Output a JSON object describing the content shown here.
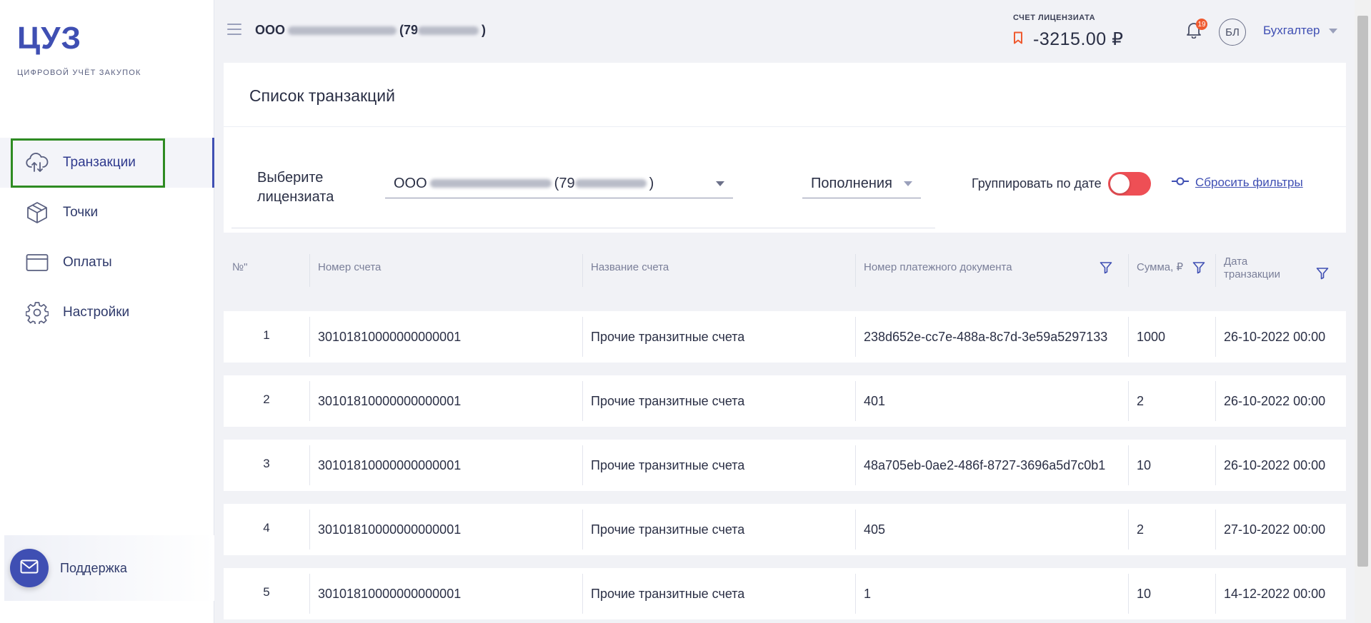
{
  "app": {
    "logo_title": "ЦУЗ",
    "logo_subtitle": "ЦИФРОВОЙ УЧЁТ ЗАКУПОК"
  },
  "sidebar": {
    "items": [
      {
        "label": "Транзакции",
        "icon": "cloud-transfer-icon",
        "active": true
      },
      {
        "label": "Точки",
        "icon": "cube-icon",
        "active": false
      },
      {
        "label": "Оплаты",
        "icon": "card-icon",
        "active": false
      },
      {
        "label": "Настройки",
        "icon": "gear-icon",
        "active": false
      }
    ],
    "support_label": "Поддержка"
  },
  "header": {
    "org_prefix": "ООО",
    "org_inn_prefix": "(79",
    "org_inn_suffix": ")",
    "account_label": "СЧЕТ ЛИЦЕНЗИАТА",
    "account_value": "-3215.00 ₽",
    "notifications_count": "19",
    "avatar_initials": "БЛ",
    "role": "Бухгалтер"
  },
  "page": {
    "title": "Список транзакций"
  },
  "filters": {
    "licensee_label_line1": "Выберите",
    "licensee_label_line2": "лицензиата",
    "licensee_prefix": "ООО",
    "licensee_inn_prefix": "(79",
    "licensee_inn_suffix": ")",
    "type_value": "Пополнения",
    "group_by_date_label": "Группировать по дате",
    "group_by_date_on": false,
    "reset_label": "Сбросить фильтры"
  },
  "table": {
    "columns": [
      {
        "label": "№\"",
        "filter": false
      },
      {
        "label": "Номер счета",
        "filter": false
      },
      {
        "label": "Название счета",
        "filter": false
      },
      {
        "label": "Номер платежного документа",
        "filter": true
      },
      {
        "label": "Сумма, ₽",
        "filter": true
      },
      {
        "label": "Дата транзакции",
        "filter": true
      }
    ],
    "rows": [
      {
        "n": "1",
        "account": "30101810000000000001",
        "name": "Прочие транзитные счета",
        "doc": "238d652e-cc7e-488a-8c7d-3e59a5297133",
        "sum": "1000",
        "date": "26-10-2022 00:00"
      },
      {
        "n": "2",
        "account": "30101810000000000001",
        "name": "Прочие транзитные счета",
        "doc": "401",
        "sum": "2",
        "date": "26-10-2022 00:00"
      },
      {
        "n": "3",
        "account": "30101810000000000001",
        "name": "Прочие транзитные счета",
        "doc": "48a705eb-0ae2-486f-8727-3696a5d7c0b1",
        "sum": "10",
        "date": "26-10-2022 00:00"
      },
      {
        "n": "4",
        "account": "30101810000000000001",
        "name": "Прочие транзитные счета",
        "doc": "405",
        "sum": "2",
        "date": "27-10-2022 00:00"
      },
      {
        "n": "5",
        "account": "30101810000000000001",
        "name": "Прочие транзитные счета",
        "doc": "1",
        "sum": "10",
        "date": "14-12-2022 00:00"
      }
    ]
  },
  "colors": {
    "accent": "#3f4fb3",
    "toggle_off": "#ee4f55",
    "badge": "#ef5a2f",
    "highlight": "#2e8b22"
  }
}
